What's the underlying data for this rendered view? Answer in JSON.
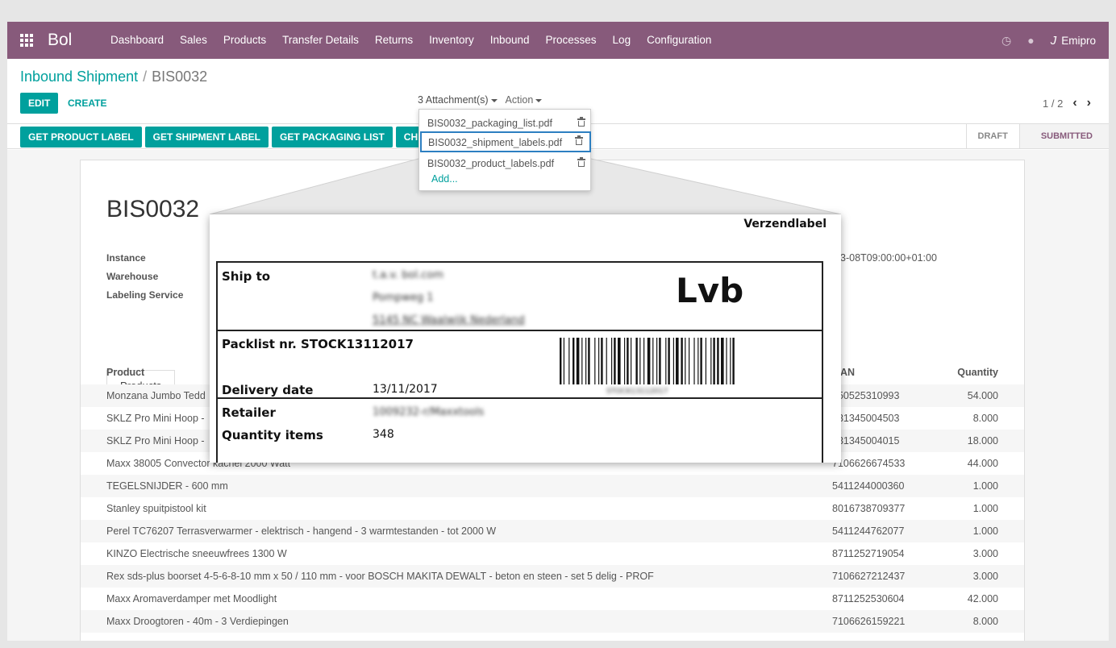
{
  "navbar": {
    "brand": "Bol",
    "menu": [
      "Dashboard",
      "Sales",
      "Products",
      "Transfer Details",
      "Returns",
      "Inventory",
      "Inbound",
      "Processes",
      "Log",
      "Configuration"
    ],
    "user": "Emipro",
    "bg_color": "#875a7b"
  },
  "breadcrumb": {
    "parent": "Inbound Shipment",
    "separator": "/",
    "current": "BIS0032"
  },
  "buttons": {
    "edit": "EDIT",
    "create": "CREATE"
  },
  "sidebar": {
    "attachments": "3 Attachment(s)",
    "action": "Action"
  },
  "pager": {
    "value": "1 / 2"
  },
  "header_buttons": [
    "GET PRODUCT LABEL",
    "GET SHIPMENT LABEL",
    "GET PACKAGING LIST",
    "CHECK SH"
  ],
  "statusbar": {
    "draft": "DRAFT",
    "submitted": "SUBMITTED",
    "active": "SUBMITTED"
  },
  "attachments": {
    "items": [
      "BIS0032_packaging_list.pdf",
      "BIS0032_shipment_labels.pdf",
      "BIS0032_product_labels.pdf"
    ],
    "highlighted": "BIS0032_shipment_labels.pdf",
    "add": "Add..."
  },
  "record": {
    "title": "BIS0032",
    "fields": [
      "Instance",
      "Warehouse",
      "Labeling Service"
    ],
    "date_partial": "3-08T09:00:00+01:00"
  },
  "tabs": [
    "Products"
  ],
  "table": {
    "headers": {
      "product": "Product",
      "ean": "AN",
      "quantity": "Quantity"
    },
    "rows": [
      {
        "product": "Monzana Jumbo Tedd",
        "ean": "250525310993",
        "qty": "54.000"
      },
      {
        "product": "SKLZ Pro Mini Hoop -",
        "ean": "331345004503",
        "qty": "8.000"
      },
      {
        "product": "SKLZ Pro Mini Hoop -",
        "ean": "331345004015",
        "qty": "18.000"
      },
      {
        "product": "Maxx 38005 Convector kachel 2000 Watt",
        "ean": "7106626674533",
        "qty": "44.000"
      },
      {
        "product": "TEGELSNIJDER - 600 mm",
        "ean": "5411244000360",
        "qty": "1.000"
      },
      {
        "product": "Stanley spuitpistool kit",
        "ean": "8016738709377",
        "qty": "1.000"
      },
      {
        "product": "Perel TC76207 Terrasverwarmer - elektrisch - hangend - 3 warmtestanden - tot 2000 W",
        "ean": "5411244762077",
        "qty": "1.000"
      },
      {
        "product": "KINZO Electrische sneeuwfrees 1300 W",
        "ean": "8711252719054",
        "qty": "3.000"
      },
      {
        "product": "Rex sds-plus boorset 4-5-6-8-10 mm x 50 / 110 mm - voor BOSCH MAKITA DEWALT - beton en steen - set 5 delig - PROF",
        "ean": "7106627212437",
        "qty": "3.000"
      },
      {
        "product": "Maxx Aromaverdamper met Moodlight",
        "ean": "8711252530604",
        "qty": "42.000"
      },
      {
        "product": "Maxx Droogtoren - 40m - 3 Verdiepingen",
        "ean": "7106626159221",
        "qty": "8.000"
      }
    ]
  },
  "label": {
    "title": "Verzendlabel",
    "ship_to_key": "Ship to",
    "ship_to_lines": [
      "t.a.v. bol.com",
      "Pompweg 1",
      "5145 NC Waalwijk Nederland"
    ],
    "lvb": "Lvb",
    "packlist": "Packlist nr. STOCK13112017",
    "barcode_text": "STOCK13112017",
    "delivery_key": "Delivery date",
    "delivery_value": "13/11/2017",
    "retailer_key": "Retailer",
    "retailer_value": "1009232-r/Maxxtools",
    "quantity_key": "Quantity items",
    "quantity_value": "348"
  }
}
